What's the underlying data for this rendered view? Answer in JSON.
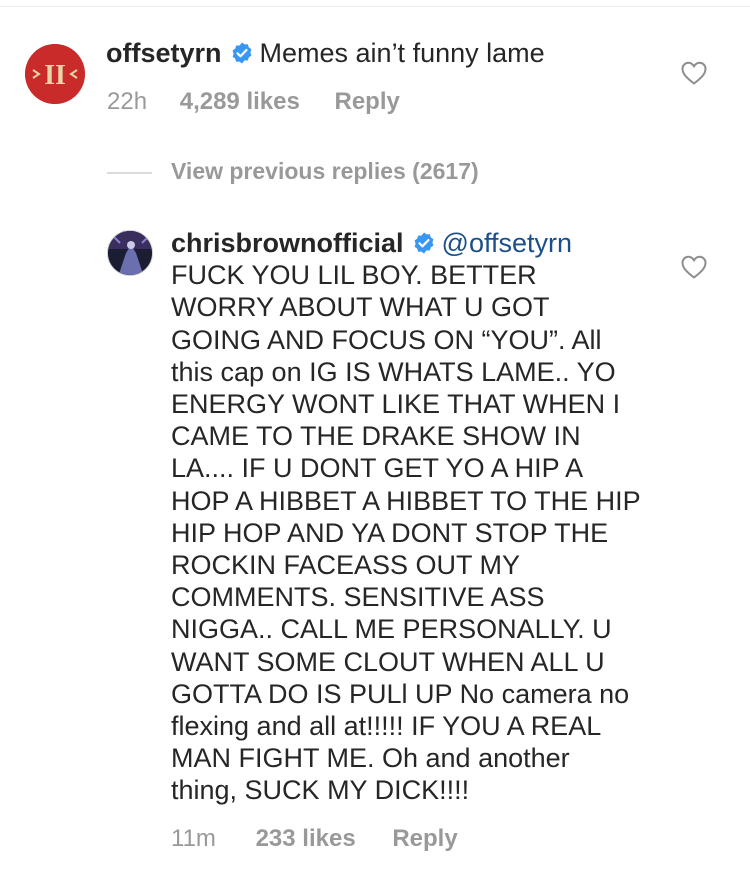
{
  "comment1": {
    "username": "offsetyrn",
    "text": "Memes ain’t funny lame",
    "time": "22h",
    "likes": "4,289 likes",
    "reply": "Reply"
  },
  "view_previous": "View previous replies (2617)",
  "comment2": {
    "username": "chrisbrownofficial",
    "mention": "@offsetyrn",
    "text": "FUCK YOU LIL BOY. BETTER WORRY ABOUT WHAT U GOT GOING AND FOCUS ON “YOU”. All this cap on IG IS WHATS LAME.. YO ENERGY WONT LIKE THAT WHEN I CAME TO THE DRAKE SHOW IN LA.... IF U DONT  GET YO A HIP A HOP A HIBBET A HIBBET TO THE HIP HIP HOP AND YA DONT STOP THE ROCKIN  FACEASS OUT MY COMMENTS. SENSITIVE ASS NIGGA.. CALL ME PERSONALLY. U WANT SOME CLOUT WHEN ALL U GOTTA DO IS PULl UP No camera no flexing and all at!!!!! IF YOU A REAL MAN FIGHT ME. Oh and another thing,  SUCK MY DICK!!!!",
    "time": "11m",
    "likes": "233 likes",
    "reply": "Reply"
  },
  "avatar1_text": "II",
  "colors": {
    "verified": "#3897f0",
    "meta": "#999999",
    "mention": "#1a4f8a"
  },
  "icons": [
    "verified-badge-icon",
    "heart-icon"
  ]
}
